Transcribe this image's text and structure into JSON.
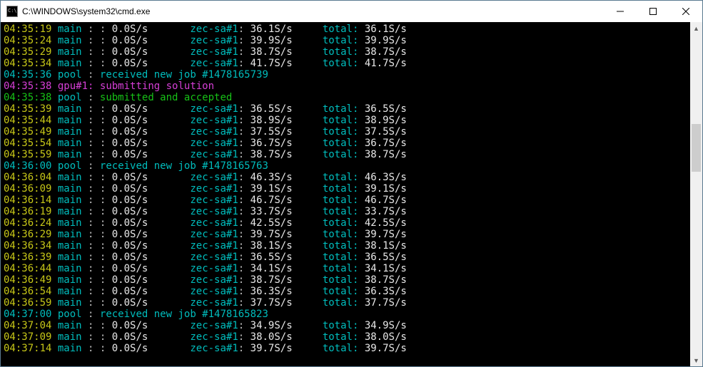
{
  "window": {
    "title": "C:\\WINDOWS\\system32\\cmd.exe"
  },
  "scrollbar": {
    "thumb_top_pct": 28,
    "thumb_height_pct": 15
  },
  "terminal": {
    "lines": [
      {
        "type": "rate",
        "time": "04:35:19",
        "src": "main",
        "main_rate": "0.0S/s",
        "dev": "zec-sa#1",
        "dev_rate": "36.1S/s",
        "total": "36.1S/s"
      },
      {
        "type": "rate",
        "time": "04:35:24",
        "src": "main",
        "main_rate": "0.0S/s",
        "dev": "zec-sa#1",
        "dev_rate": "39.9S/s",
        "total": "39.9S/s"
      },
      {
        "type": "rate",
        "time": "04:35:29",
        "src": "main",
        "main_rate": "0.0S/s",
        "dev": "zec-sa#1",
        "dev_rate": "38.7S/s",
        "total": "38.7S/s"
      },
      {
        "type": "rate",
        "time": "04:35:34",
        "src": "main",
        "main_rate": "0.0S/s",
        "dev": "zec-sa#1",
        "dev_rate": "41.7S/s",
        "total": "41.7S/s"
      },
      {
        "type": "pool-job",
        "time": "04:35:36",
        "job": "#1478165739"
      },
      {
        "type": "gpu-submit",
        "time": "04:35:38",
        "gpu": "gpu#1"
      },
      {
        "type": "pool-accept",
        "time": "04:35:38"
      },
      {
        "type": "rate",
        "time": "04:35:39",
        "src": "main",
        "main_rate": "0.0S/s",
        "dev": "zec-sa#1",
        "dev_rate": "36.5S/s",
        "total": "36.5S/s"
      },
      {
        "type": "rate",
        "time": "04:35:44",
        "src": "main",
        "main_rate": "0.0S/s",
        "dev": "zec-sa#1",
        "dev_rate": "38.9S/s",
        "total": "38.9S/s"
      },
      {
        "type": "rate",
        "time": "04:35:49",
        "src": "main",
        "main_rate": "0.0S/s",
        "dev": "zec-sa#1",
        "dev_rate": "37.5S/s",
        "total": "37.5S/s"
      },
      {
        "type": "rate",
        "time": "04:35:54",
        "src": "main",
        "main_rate": "0.0S/s",
        "dev": "zec-sa#1",
        "dev_rate": "36.7S/s",
        "total": "36.7S/s"
      },
      {
        "type": "rate",
        "time": "04:35:59",
        "src": "main",
        "main_rate": "0.0S/s",
        "dev": "zec-sa#1",
        "dev_rate": "38.7S/s",
        "total": "38.7S/s"
      },
      {
        "type": "pool-job",
        "time": "04:36:00",
        "job": "#1478165763"
      },
      {
        "type": "rate",
        "time": "04:36:04",
        "src": "main",
        "main_rate": "0.0S/s",
        "dev": "zec-sa#1",
        "dev_rate": "46.3S/s",
        "total": "46.3S/s"
      },
      {
        "type": "rate",
        "time": "04:36:09",
        "src": "main",
        "main_rate": "0.0S/s",
        "dev": "zec-sa#1",
        "dev_rate": "39.1S/s",
        "total": "39.1S/s"
      },
      {
        "type": "rate",
        "time": "04:36:14",
        "src": "main",
        "main_rate": "0.0S/s",
        "dev": "zec-sa#1",
        "dev_rate": "46.7S/s",
        "total": "46.7S/s"
      },
      {
        "type": "rate",
        "time": "04:36:19",
        "src": "main",
        "main_rate": "0.0S/s",
        "dev": "zec-sa#1",
        "dev_rate": "33.7S/s",
        "total": "33.7S/s"
      },
      {
        "type": "rate",
        "time": "04:36:24",
        "src": "main",
        "main_rate": "0.0S/s",
        "dev": "zec-sa#1",
        "dev_rate": "42.5S/s",
        "total": "42.5S/s"
      },
      {
        "type": "rate",
        "time": "04:36:29",
        "src": "main",
        "main_rate": "0.0S/s",
        "dev": "zec-sa#1",
        "dev_rate": "39.7S/s",
        "total": "39.7S/s"
      },
      {
        "type": "rate",
        "time": "04:36:34",
        "src": "main",
        "main_rate": "0.0S/s",
        "dev": "zec-sa#1",
        "dev_rate": "38.1S/s",
        "total": "38.1S/s"
      },
      {
        "type": "rate",
        "time": "04:36:39",
        "src": "main",
        "main_rate": "0.0S/s",
        "dev": "zec-sa#1",
        "dev_rate": "36.5S/s",
        "total": "36.5S/s"
      },
      {
        "type": "rate",
        "time": "04:36:44",
        "src": "main",
        "main_rate": "0.0S/s",
        "dev": "zec-sa#1",
        "dev_rate": "34.1S/s",
        "total": "34.1S/s"
      },
      {
        "type": "rate",
        "time": "04:36:49",
        "src": "main",
        "main_rate": "0.0S/s",
        "dev": "zec-sa#1",
        "dev_rate": "38.7S/s",
        "total": "38.7S/s"
      },
      {
        "type": "rate",
        "time": "04:36:54",
        "src": "main",
        "main_rate": "0.0S/s",
        "dev": "zec-sa#1",
        "dev_rate": "36.3S/s",
        "total": "36.3S/s"
      },
      {
        "type": "rate",
        "time": "04:36:59",
        "src": "main",
        "main_rate": "0.0S/s",
        "dev": "zec-sa#1",
        "dev_rate": "37.7S/s",
        "total": "37.7S/s"
      },
      {
        "type": "pool-job",
        "time": "04:37:00",
        "job": "#1478165823"
      },
      {
        "type": "rate",
        "time": "04:37:04",
        "src": "main",
        "main_rate": "0.0S/s",
        "dev": "zec-sa#1",
        "dev_rate": "34.9S/s",
        "total": "34.9S/s"
      },
      {
        "type": "rate",
        "time": "04:37:09",
        "src": "main",
        "main_rate": "0.0S/s",
        "dev": "zec-sa#1",
        "dev_rate": "38.0S/s",
        "total": "38.0S/s"
      },
      {
        "type": "rate",
        "time": "04:37:14",
        "src": "main",
        "main_rate": "0.0S/s",
        "dev": "zec-sa#1",
        "dev_rate": "39.7S/s",
        "total": "39.7S/s"
      }
    ],
    "labels": {
      "total_prefix": "total:",
      "pool": "pool",
      "pool_job_text": "received new job",
      "gpu_submit_text": "submitting solution",
      "pool_accept_text": "submitted and accepted"
    }
  }
}
